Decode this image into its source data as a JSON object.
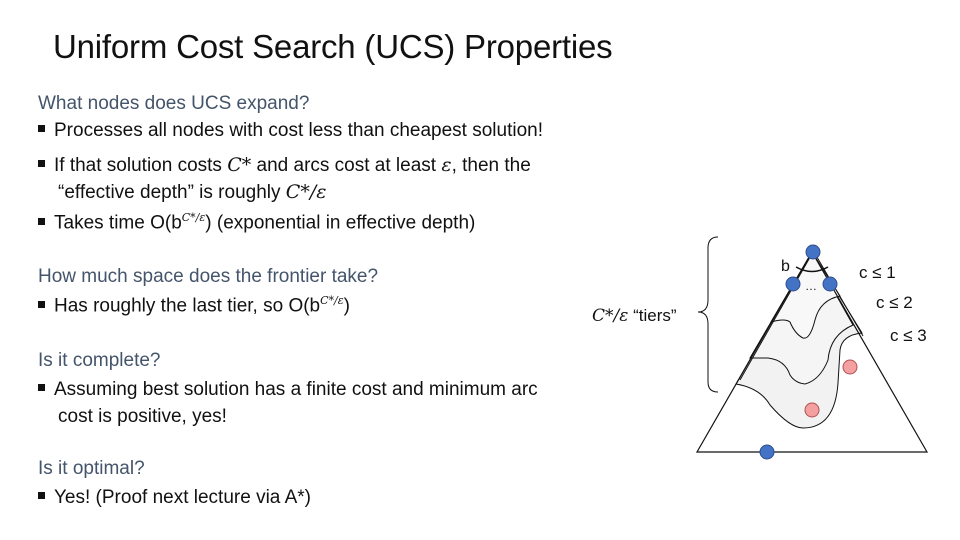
{
  "slide": {
    "title": "Uniform Cost Search (UCS) Properties",
    "sections": [
      {
        "question": "What nodes does UCS expand?",
        "bullets": [
          "Processes all nodes with cost less than cheapest solution!",
          "If that solution costs",
          "C*",
          "and arcs cost at least",
          "ε",
          ", then the",
          "“effective depth” is roughly",
          "C*/ε",
          "Takes time O(b",
          "C*/ε",
          ") (exponential in effective depth)"
        ]
      },
      {
        "question": "How much space does the frontier take?",
        "bullets": [
          "Has roughly the last tier, so O(b",
          "C*/ε",
          ")"
        ]
      },
      {
        "question": "Is it complete?",
        "bullets": [
          "Assuming best solution has a finite cost and minimum arc",
          "cost is positive, yes!"
        ]
      },
      {
        "question": "Is it optimal?",
        "bullets": [
          "Yes!  (Proof next lecture via A*)"
        ]
      }
    ],
    "diagram": {
      "tiers_math": "C*/ε",
      "tiers_label": "“tiers”",
      "branch_label": "b",
      "ellipsis": "…",
      "cost_labels": [
        "c ≤ 1",
        "c ≤ 2",
        "c ≤ 3"
      ],
      "colors": {
        "node_blue": "#4472c4",
        "node_red": "#f4a0a0",
        "tier_fill": "#f2f2f2",
        "question": "#44546a"
      }
    }
  }
}
